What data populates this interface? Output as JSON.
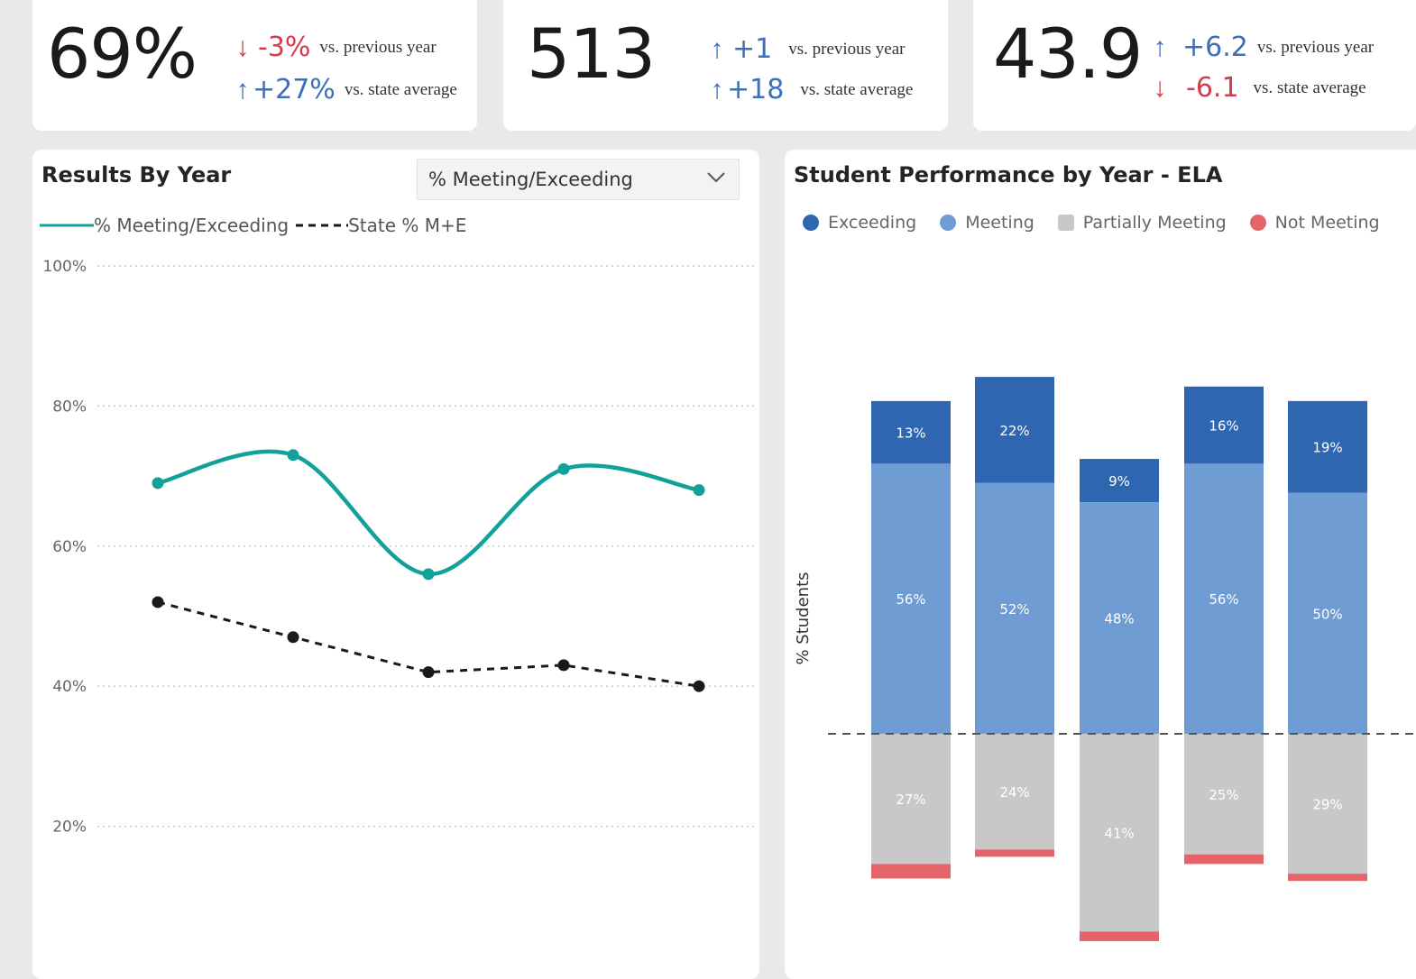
{
  "kpis": [
    {
      "value": "69%",
      "rows": [
        {
          "direction": "down",
          "arrow": "↓",
          "delta": "-3%",
          "note": "vs. previous year"
        },
        {
          "direction": "up",
          "arrow": "↑",
          "delta": "+27%",
          "note": "vs. state average"
        }
      ]
    },
    {
      "value": "513",
      "rows": [
        {
          "direction": "up",
          "arrow": "↑",
          "delta": "+1",
          "note": "vs. previous year"
        },
        {
          "direction": "up",
          "arrow": "↑",
          "delta": "+18",
          "note": "vs. state average"
        }
      ]
    },
    {
      "value": "43.9",
      "rows": [
        {
          "direction": "up",
          "arrow": "↑",
          "delta": "+6.2",
          "note": "vs. previous year"
        },
        {
          "direction": "down",
          "arrow": "↓",
          "delta": "-6.1",
          "note": "vs. state average"
        }
      ]
    }
  ],
  "results_by_year": {
    "title": "Results By Year",
    "dropdown_value": "% Meeting/Exceeding",
    "legend": {
      "series1": "% Meeting/Exceeding",
      "series2": "State % M+E"
    }
  },
  "student_performance": {
    "title": "Student Performance by Year - ELA",
    "y_axis_label": "% Students",
    "legend": [
      "Exceeding",
      "Meeting",
      "Partially Meeting",
      "Not Meeting"
    ]
  },
  "colors": {
    "teal": "#12a19a",
    "state": "#1a1a1a",
    "exceeding": "#2f66b1",
    "meeting": "#6e9cd3",
    "partial": "#c8c8c8",
    "not_meeting": "#e46469",
    "up": "#3b6fb6",
    "down": "#d33c4c"
  },
  "chart_data": [
    {
      "type": "line",
      "title": "Results By Year",
      "x": [
        1,
        2,
        3,
        4,
        5
      ],
      "series": [
        {
          "name": "% Meeting/Exceeding",
          "values": [
            69,
            73,
            56,
            71,
            68
          ]
        },
        {
          "name": "State % M+E",
          "values": [
            52,
            47,
            42,
            43,
            40
          ]
        }
      ],
      "y_ticks": [
        "100%",
        "80%",
        "60%",
        "40%",
        "20%"
      ],
      "ylim": [
        0,
        100
      ],
      "grid": true,
      "legend_position": "top-left"
    },
    {
      "type": "bar",
      "title": "Student Performance by Year - ELA",
      "ylabel": "% Students",
      "stacked": "diverging",
      "series": [
        {
          "name": "Exceeding",
          "values": [
            13,
            22,
            9,
            16,
            19
          ],
          "labels": [
            "13%",
            "22%",
            "9%",
            "16%",
            "19%"
          ]
        },
        {
          "name": "Meeting",
          "values": [
            56,
            52,
            48,
            56,
            50
          ],
          "labels": [
            "56%",
            "52%",
            "48%",
            "56%",
            "50%"
          ]
        },
        {
          "name": "Partially Meeting",
          "values": [
            27,
            24,
            41,
            25,
            29
          ],
          "labels": [
            "27%",
            "24%",
            "41%",
            "25%",
            "29%"
          ]
        },
        {
          "name": "Not Meeting",
          "values": [
            3,
            1.5,
            2,
            2,
            1.5
          ]
        }
      ],
      "grid": false,
      "legend_position": "top-left"
    }
  ]
}
